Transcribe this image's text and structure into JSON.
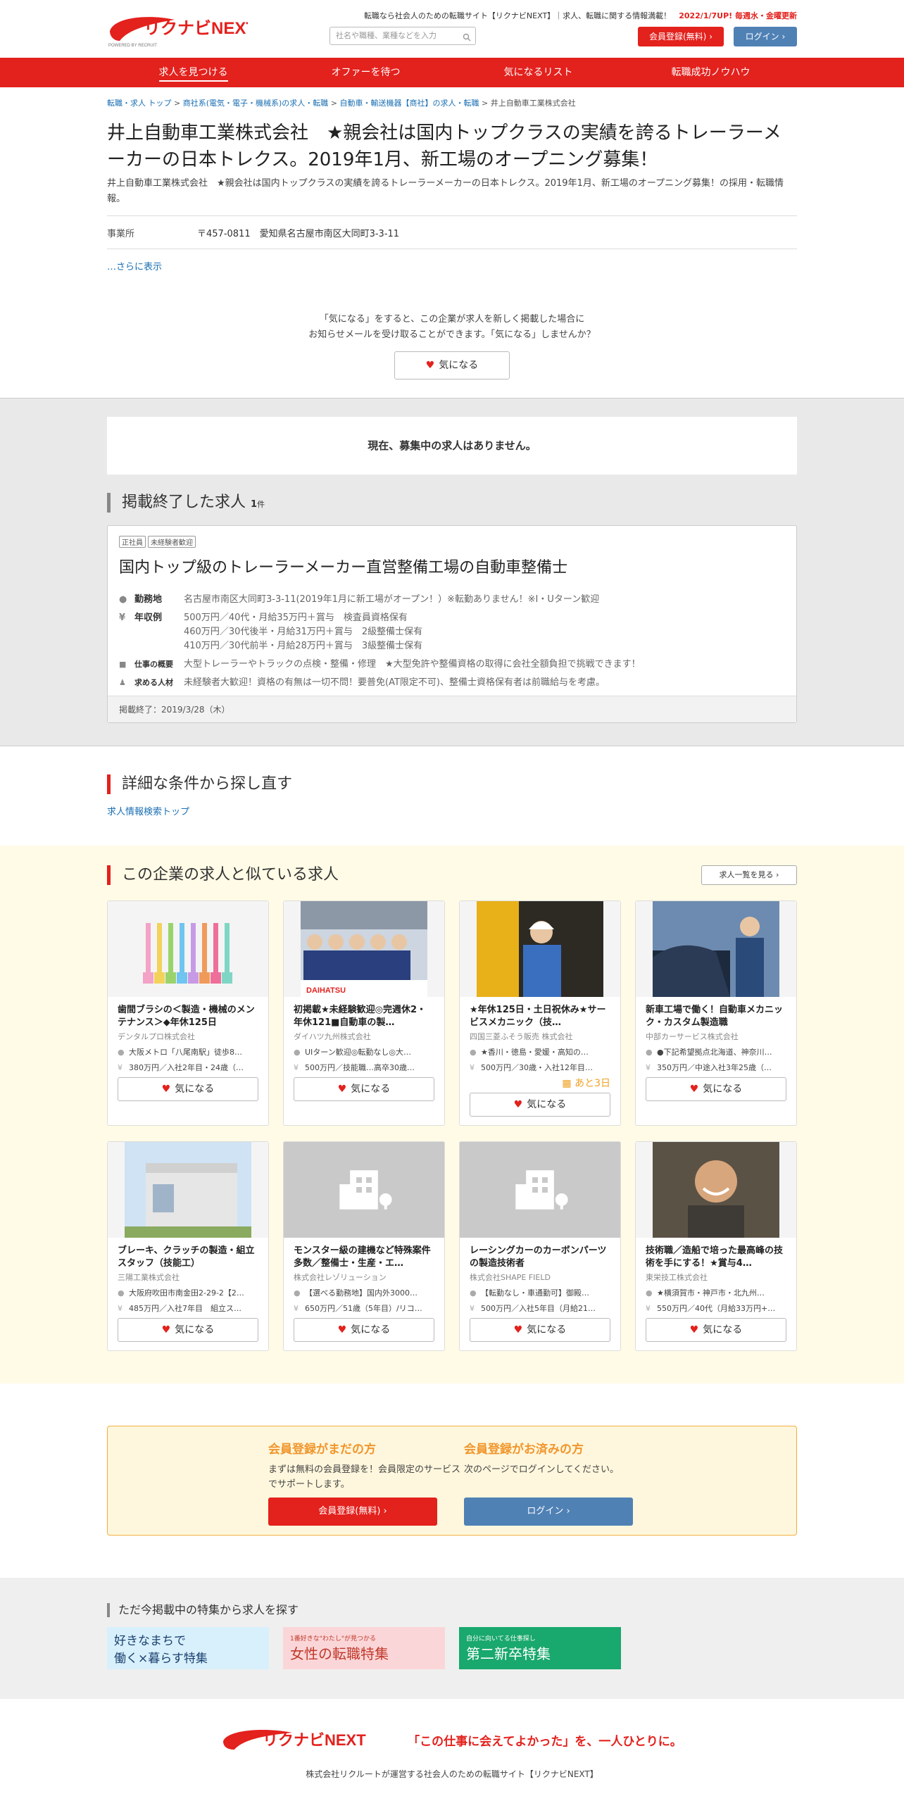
{
  "header": {
    "logo_text": "リクナビNEXT",
    "logo_sub": "POWERED BY RECRUIT",
    "tagline": "転職なら社会人のための転職サイト【リクナビNEXT】｜求人、転職に関する情報満載！",
    "update": "2022/1/7UP! 毎週水・金曜更新",
    "search_placeholder": "社名や職種、業種などを入力",
    "register": "会員登録(無料)",
    "login": "ログイン"
  },
  "nav": [
    "求人を見つける",
    "オファーを待つ",
    "気になるリスト",
    "転職成功ノウハウ"
  ],
  "breadcrumb": [
    "転職・求人 トップ",
    "商社系(電気・電子・機械系)の求人・転職",
    "自動車・輸送機器【商社】の求人・転職",
    "井上自動車工業株式会社"
  ],
  "company": {
    "title": "井上自動車工業株式会社　★親会社は国内トップクラスの実績を誇るトレーラーメーカーの日本トレクス。2019年1月、新工場のオープニング募集！",
    "desc": "井上自動車工業株式会社　★親会社は国内トップクラスの実績を誇るトレーラーメーカーの日本トレクス。2019年1月、新工場のオープニング募集！の採用・転職情報。",
    "office_label": "事業所",
    "office_value": "〒457-0811　愛知県名古屋市南区大同町3-3-11",
    "more": "…さらに表示"
  },
  "favorite": {
    "line1": "「気になる」をすると、この企業が求人を新しく掲載した場合に",
    "line2": "お知らせメールを受け取ることができます。「気になる」しませんか？",
    "button": "気になる"
  },
  "no_jobs": "現在、募集中の求人はありません。",
  "ended": {
    "heading": "掲載終了した求人",
    "count": "1",
    "unit": "件",
    "tags": [
      "正社員",
      "未経験者歓迎"
    ],
    "title": "国内トップ級のトレーラーメーカー直営整備工場の自動車整備士",
    "rows": [
      {
        "icon": "location-pin-icon",
        "label": "勤務地",
        "lines": [
          "名古屋市南区大同町3-3-11(2019年1月に新工場がオープン！）※転勤ありません！※I・Uターン歓迎"
        ]
      },
      {
        "icon": "yen-icon",
        "label": "年収例",
        "lines": [
          "500万円／40代・月給35万円＋賞与　検査員資格保有",
          "460万円／30代後半・月給31万円＋賞与　2級整備士保有",
          "410万円／30代前半・月給28万円＋賞与　3級整備士保有"
        ]
      },
      {
        "icon": "briefcase-icon",
        "label": "仕事の概要",
        "lines": [
          "大型トレーラーやトラックの点検・整備・修理　★大型免許や整備資格の取得に会社全額負担で挑戦できます！"
        ]
      },
      {
        "icon": "person-icon",
        "label": "求める人材",
        "lines": [
          "未経験者大歓迎！資格の有無は一切不問！要普免(AT限定不可)、整備士資格保有者は前職給与を考慮。"
        ]
      }
    ],
    "end_date": "掲載終了：2019/3/28（木）"
  },
  "detail_search": {
    "heading": "詳細な条件から探し直す",
    "link": "求人情報検索トップ"
  },
  "similar": {
    "heading": "この企業の求人と似ている求人",
    "list_button": "求人一覧を見る",
    "fav_label": "気になる",
    "cards": [
      {
        "title": "歯間ブラシの＜製造・機械のメンテナンス＞◆年休125日",
        "company": "デンタルプロ株式会社",
        "loc": "大阪メトロ「八尾南駅」徒歩8…",
        "pay": "380万円／入社2年目・24歳（…",
        "soon": "",
        "img": "brush"
      },
      {
        "title": "初掲載★未経験歓迎◎完週休2・年休121■自動車の製…",
        "company": "ダイハツ九州株式会社",
        "loc": "UIターン歓迎◎転勤なし◎大…",
        "pay": "500万円／技能職…高卒30歳…",
        "soon": "",
        "img": "team"
      },
      {
        "title": "★年休125日・土日祝休み★サービスメカニック（技…",
        "company": "四国三菱ふそう販売 株式会社",
        "loc": "★香川・徳島・愛媛・高知の…",
        "pay": "500万円／30歳・入社12年目…",
        "soon": "あと3日",
        "img": "mechanic"
      },
      {
        "title": "新車工場で働く！自動車メカニック・カスタム製造職",
        "company": "中部カーサービス株式会社",
        "loc": "●下記希望拠点北海道、神奈川…",
        "pay": "350万円／中途入社3年25歳（…",
        "soon": "",
        "img": "car"
      },
      {
        "title": "ブレーキ、クラッチの製造・組立スタッフ（技能工）",
        "company": "三陽工業株式会社",
        "loc": "大阪府吹田市南金田2-29-2【2…",
        "pay": "485万円／入社7年目　組立ス…",
        "soon": "",
        "img": "building"
      },
      {
        "title": "モンスター級の建機など特殊案件多数／整備士・生産・エ…",
        "company": "株式会社レゾリューション",
        "loc": "【選べる勤務地】国内外3000…",
        "pay": "650万円／51歳（5年目）/リコ…",
        "soon": "",
        "img": "none"
      },
      {
        "title": "レーシングカーのカーボンパーツの製造技術者",
        "company": "株式会社SHAPE FIELD",
        "loc": "【転勤なし・車通勤可】御殿…",
        "pay": "500万円／入社5年目（月給21…",
        "soon": "",
        "img": "none"
      },
      {
        "title": "技術職／造船で培った最高峰の技術を手にする！★賞与4…",
        "company": "東栄技工株式会社",
        "loc": "★横須賀市・神戸市・北九州…",
        "pay": "550万円／40代（月給33万円+…",
        "soon": "",
        "img": "smile"
      }
    ]
  },
  "member": {
    "new_title": "会員登録がまだの方",
    "new_text": "まずは無料の会員登録を！会員限定のサービスでサポートします。",
    "new_button": "会員登録(無料)",
    "exist_title": "会員登録がお済みの方",
    "exist_text": "次のページでログインしてください。",
    "exist_button": "ログイン"
  },
  "features": {
    "heading": "ただ今掲載中の特集から求人を探す",
    "banners": [
      {
        "text": "好きなまちで働く×暮らす特集",
        "line1": "好きなまちで",
        "line2": "働く×暮らす特集"
      },
      {
        "text": "女性の転職特集",
        "line1": "1番好きな\"わたし\"が見つかる",
        "line2": "女性の転職特集"
      },
      {
        "text": "第二新卒特集",
        "line1": "自分に向いてる仕事探し",
        "line2": "第二新卒特集"
      }
    ]
  },
  "footer": {
    "slogan": "「この仕事に会えてよかった」を、一人ひとりに。",
    "copy": "株式会社リクルートが運営する社会人のための転職サイト【リクナビNEXT】"
  },
  "colors": {
    "brand_red": "#e3211d",
    "login_blue": "#4f81b5",
    "orange": "#f0962c"
  }
}
